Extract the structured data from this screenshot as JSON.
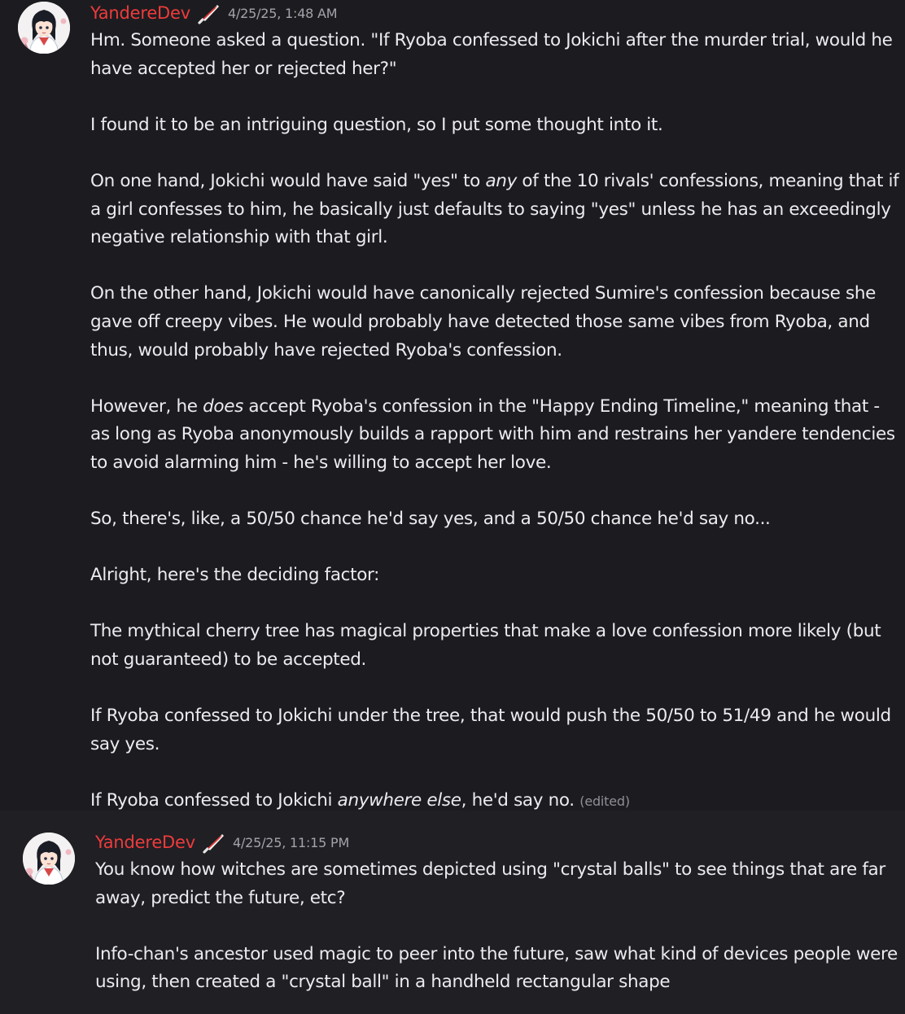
{
  "messages": [
    {
      "author": "YandereDev",
      "timestamp": "4/25/25, 1:48 AM",
      "paragraphs": [
        [
          "Hm. Someone asked a question. \"If Ryoba confessed to Jokichi after the murder trial, would he have accepted her or rejected her?\""
        ],
        [
          "I found it to be an intriguing question, so I put some thought into it."
        ],
        [
          "On one hand, Jokichi would have said \"yes\" to ",
          "any",
          " of the 10 rivals' confessions, meaning that if a girl confesses to him, he basically just defaults to saying \"yes\" unless he has an exceedingly negative relationship with that girl."
        ],
        [
          "On the other hand, Jokichi would have canonically rejected Sumire's confession because she gave off creepy vibes. He would probably have detected those same vibes from Ryoba, and thus, would probably have rejected Ryoba's confession."
        ],
        [
          "However, he ",
          "does",
          " accept Ryoba's confession in the \"Happy Ending Timeline,\" meaning that - as long as Ryoba anonymously builds a rapport with him and restrains her yandere tendencies to avoid alarming him - he's willing to accept her love."
        ],
        [
          "So, there's, like, a 50/50 chance he'd say yes, and a 50/50 chance he'd say no..."
        ],
        [
          "Alright, here's the deciding factor:"
        ],
        [
          "The mythical cherry tree has magical properties that make a love confession more likely (but not guaranteed) to be accepted."
        ],
        [
          "If Ryoba confessed to Jokichi under the tree, that would push the 50/50 to 51/49 and he would say yes."
        ],
        [
          "If Ryoba confessed to Jokichi ",
          "anywhere else",
          ", he'd say no. "
        ]
      ],
      "edited_label": "(edited)"
    },
    {
      "author": "YandereDev",
      "timestamp": "4/25/25, 11:15 PM",
      "paragraphs": [
        [
          "You know how witches are sometimes depicted using \"crystal balls\" to see things that are far away, predict the future, etc?"
        ],
        [
          "Info-chan's ancestor used magic to peer into the future, saw what kind of devices people were using, then created a \"crystal ball\" in a handheld rectangular shape"
        ]
      ]
    }
  ],
  "icons": {
    "avatar": "avatar-anime-girl-icon",
    "badge": "knife-icon"
  },
  "colors": {
    "background": "#1c1c20",
    "author": "#ee3b3b",
    "text": "#ececef",
    "timestamp": "#a3a4ab",
    "edited": "#8e8f96"
  }
}
